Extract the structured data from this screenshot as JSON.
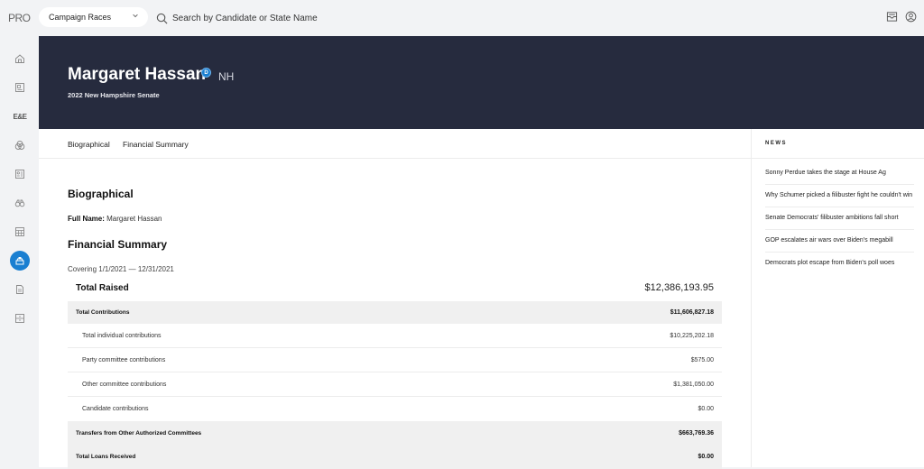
{
  "topbar": {
    "logo": "PRO",
    "dropdown_value": "Campaign Races",
    "search_placeholder": "Search by Candidate or State Name",
    "icons": [
      "inbox-icon",
      "account-icon"
    ]
  },
  "sidebar": {
    "items": [
      {
        "name": "home",
        "icon": "home-icon"
      },
      {
        "name": "newsletters",
        "icon": "newspaper-icon"
      },
      {
        "name": "ee",
        "label": "E&E"
      },
      {
        "name": "policy",
        "icon": "venn-icon"
      },
      {
        "name": "people",
        "icon": "contact-card-icon"
      },
      {
        "name": "watch",
        "icon": "binoculars-icon"
      },
      {
        "name": "calendar",
        "icon": "calendar-grid-icon"
      },
      {
        "name": "campaigns",
        "icon": "ballot-box-icon",
        "active": true
      },
      {
        "name": "documents",
        "icon": "document-icon"
      },
      {
        "name": "archive",
        "icon": "archive-icon"
      }
    ],
    "accent_color": "#1a7fd1"
  },
  "hero": {
    "name": "Margaret Hassan",
    "party": "D",
    "state": "NH",
    "race": "2022 New Hampshire Senate",
    "background_color": "#262b3e"
  },
  "tabs": [
    "Biographical",
    "Financial Summary"
  ],
  "biographical": {
    "heading": "Biographical",
    "full_name_label": "Full Name:",
    "full_name_value": "Margaret Hassan"
  },
  "financial": {
    "heading": "Financial Summary",
    "covering": "Covering 1/1/2021 — 12/31/2021",
    "total_raised_label": "Total Raised",
    "total_raised_value": "$12,386,193.95",
    "rows": [
      {
        "type": "group",
        "label": "Total Contributions",
        "value": "$11,606,827.18"
      },
      {
        "type": "sub",
        "label": "Total individual contributions",
        "value": "$10,225,202.18"
      },
      {
        "type": "sub",
        "label": "Party committee contributions",
        "value": "$575.00"
      },
      {
        "type": "sub",
        "label": "Other committee contributions",
        "value": "$1,381,050.00"
      },
      {
        "type": "sub",
        "label": "Candidate contributions",
        "value": "$0.00"
      },
      {
        "type": "group",
        "label": "Transfers from Other Authorized Committees",
        "value": "$663,769.36"
      },
      {
        "type": "group",
        "label": "Total Loans Received",
        "value": "$0.00"
      }
    ]
  },
  "news": {
    "title": "NEWS",
    "items": [
      "Sonny Perdue takes the stage at House Ag",
      "Why Schumer picked a filibuster fight he couldn't win",
      "Senate Democrats' filibuster ambitions fall short",
      "GOP escalates air wars over Biden's megabill",
      "Democrats plot escape from Biden's poll woes"
    ]
  }
}
